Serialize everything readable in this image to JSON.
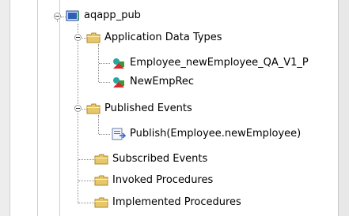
{
  "tree": {
    "root": {
      "label": "aqapp_pub",
      "icon": "folder-blue-icon"
    },
    "application_data_types": {
      "label": "Application Data Types",
      "children": [
        {
          "label": "Employee_newEmployee_QA_V1_P",
          "icon": "data-type-icon"
        },
        {
          "label": "NewEmpRec",
          "icon": "data-type-icon"
        }
      ]
    },
    "published_events": {
      "label": "Published Events",
      "children": [
        {
          "label": "Publish(Employee.newEmployee)",
          "icon": "publish-icon"
        }
      ]
    },
    "subscribed_events": {
      "label": "Subscribed Events"
    },
    "invoked_procedures": {
      "label": "Invoked Procedures"
    },
    "implemented_procedures": {
      "label": "Implemented Procedures"
    }
  },
  "colors": {
    "folder": "#e6c86b",
    "folder_dark": "#b08a2a",
    "blue_folder": "#2f5fb7",
    "teal": "#2aa6a0",
    "red": "#d42a2a",
    "green": "#3a9a3a"
  }
}
